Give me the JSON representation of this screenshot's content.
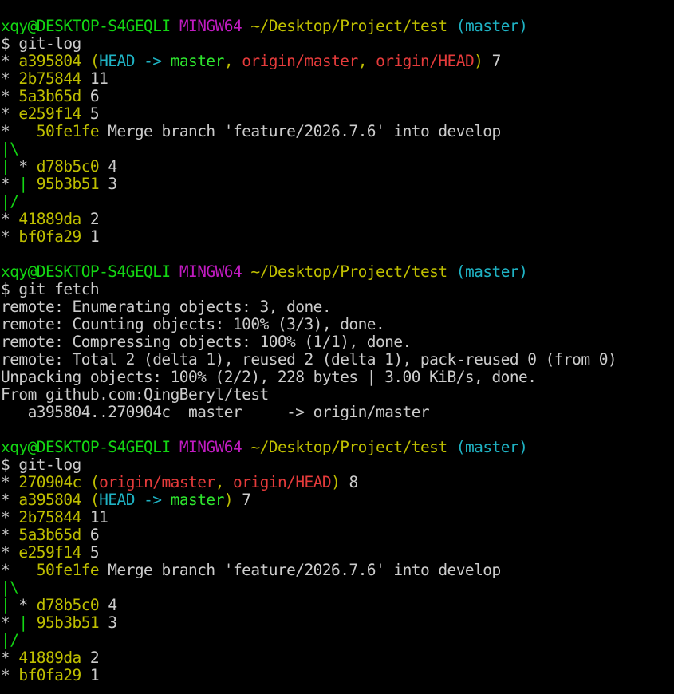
{
  "colors": {
    "default": "#cccccc",
    "green": "#13d613",
    "magenta": "#c11bc1",
    "yellow": "#bfbf00",
    "cyan": "#1fb3c4",
    "blue": "#2a8ff0",
    "red": "#e53b3b",
    "bright_green": "#2ee62e",
    "white": "#cccccc"
  },
  "lines": [
    {
      "type": "prompt",
      "segments": [
        {
          "text": "xqy@DESKTOP-S4GEQLI",
          "color": "green"
        },
        {
          "text": " ",
          "color": "default"
        },
        {
          "text": "MINGW64",
          "color": "magenta"
        },
        {
          "text": " ",
          "color": "default"
        },
        {
          "text": "~/Desktop/Project/test",
          "color": "yellow"
        },
        {
          "text": " ",
          "color": "default"
        },
        {
          "text": "(master)",
          "color": "cyan"
        }
      ]
    },
    {
      "type": "command",
      "segments": [
        {
          "text": "$ git-log",
          "color": "white"
        }
      ]
    },
    {
      "type": "log",
      "segments": [
        {
          "text": "* ",
          "color": "white"
        },
        {
          "text": "a395804",
          "color": "yellow"
        },
        {
          "text": " ",
          "color": "white"
        },
        {
          "text": "(",
          "color": "yellow"
        },
        {
          "text": "HEAD -> ",
          "color": "cyan"
        },
        {
          "text": "master",
          "color": "bright_green"
        },
        {
          "text": ", ",
          "color": "yellow"
        },
        {
          "text": "origin/master",
          "color": "red"
        },
        {
          "text": ", ",
          "color": "yellow"
        },
        {
          "text": "origin/HEAD",
          "color": "red"
        },
        {
          "text": ")",
          "color": "yellow"
        },
        {
          "text": " 7",
          "color": "white"
        }
      ]
    },
    {
      "type": "log",
      "segments": [
        {
          "text": "* ",
          "color": "white"
        },
        {
          "text": "2b75844",
          "color": "yellow"
        },
        {
          "text": " 11",
          "color": "white"
        }
      ]
    },
    {
      "type": "log",
      "segments": [
        {
          "text": "* ",
          "color": "white"
        },
        {
          "text": "5a3b65d",
          "color": "yellow"
        },
        {
          "text": " 6",
          "color": "white"
        }
      ]
    },
    {
      "type": "log",
      "segments": [
        {
          "text": "* ",
          "color": "white"
        },
        {
          "text": "e259f14",
          "color": "yellow"
        },
        {
          "text": " 5",
          "color": "white"
        }
      ]
    },
    {
      "type": "log",
      "segments": [
        {
          "text": "*   ",
          "color": "white"
        },
        {
          "text": "50fe1fe",
          "color": "yellow"
        },
        {
          "text": " Merge branch 'feature/2026.7.6' into develop",
          "color": "white"
        }
      ]
    },
    {
      "type": "graph",
      "segments": [
        {
          "text": "|\\",
          "color": "green"
        }
      ]
    },
    {
      "type": "log",
      "segments": [
        {
          "text": "|",
          "color": "green"
        },
        {
          "text": " * ",
          "color": "white"
        },
        {
          "text": "d78b5c0",
          "color": "yellow"
        },
        {
          "text": " 4",
          "color": "white"
        }
      ]
    },
    {
      "type": "log",
      "segments": [
        {
          "text": "* ",
          "color": "white"
        },
        {
          "text": "|",
          "color": "green"
        },
        {
          "text": " ",
          "color": "white"
        },
        {
          "text": "95b3b51",
          "color": "yellow"
        },
        {
          "text": " 3",
          "color": "white"
        }
      ]
    },
    {
      "type": "graph",
      "segments": [
        {
          "text": "|/",
          "color": "green"
        }
      ]
    },
    {
      "type": "log",
      "segments": [
        {
          "text": "* ",
          "color": "white"
        },
        {
          "text": "41889da",
          "color": "yellow"
        },
        {
          "text": " 2",
          "color": "white"
        }
      ]
    },
    {
      "type": "log",
      "segments": [
        {
          "text": "* ",
          "color": "white"
        },
        {
          "text": "bf0fa29",
          "color": "yellow"
        },
        {
          "text": " 1",
          "color": "white"
        }
      ]
    },
    {
      "type": "blank",
      "segments": []
    },
    {
      "type": "prompt",
      "segments": [
        {
          "text": "xqy@DESKTOP-S4GEQLI",
          "color": "green"
        },
        {
          "text": " ",
          "color": "default"
        },
        {
          "text": "MINGW64",
          "color": "magenta"
        },
        {
          "text": " ",
          "color": "default"
        },
        {
          "text": "~/Desktop/Project/test",
          "color": "yellow"
        },
        {
          "text": " ",
          "color": "default"
        },
        {
          "text": "(master)",
          "color": "cyan"
        }
      ]
    },
    {
      "type": "command",
      "segments": [
        {
          "text": "$ git fetch",
          "color": "white"
        }
      ]
    },
    {
      "type": "output",
      "segments": [
        {
          "text": "remote: Enumerating objects: 3, done.",
          "color": "white"
        }
      ]
    },
    {
      "type": "output",
      "segments": [
        {
          "text": "remote: Counting objects: 100% (3/3), done.",
          "color": "white"
        }
      ]
    },
    {
      "type": "output",
      "segments": [
        {
          "text": "remote: Compressing objects: 100% (1/1), done.",
          "color": "white"
        }
      ]
    },
    {
      "type": "output",
      "segments": [
        {
          "text": "remote: Total 2 (delta 1), reused 2 (delta 1), pack-reused 0 (from 0)",
          "color": "white"
        }
      ]
    },
    {
      "type": "output",
      "segments": [
        {
          "text": "Unpacking objects: 100% (2/2), 228 bytes | 3.00 KiB/s, done.",
          "color": "white"
        }
      ]
    },
    {
      "type": "output",
      "segments": [
        {
          "text": "From github.com:QingBeryl/test",
          "color": "white"
        }
      ]
    },
    {
      "type": "output",
      "segments": [
        {
          "text": "   a395804..270904c  master     -> origin/master",
          "color": "white"
        }
      ]
    },
    {
      "type": "blank",
      "segments": []
    },
    {
      "type": "prompt",
      "segments": [
        {
          "text": "xqy@DESKTOP-S4GEQLI",
          "color": "green"
        },
        {
          "text": " ",
          "color": "default"
        },
        {
          "text": "MINGW64",
          "color": "magenta"
        },
        {
          "text": " ",
          "color": "default"
        },
        {
          "text": "~/Desktop/Project/test",
          "color": "yellow"
        },
        {
          "text": " ",
          "color": "default"
        },
        {
          "text": "(master)",
          "color": "cyan"
        }
      ]
    },
    {
      "type": "command",
      "segments": [
        {
          "text": "$ git-log",
          "color": "white"
        }
      ]
    },
    {
      "type": "log",
      "segments": [
        {
          "text": "* ",
          "color": "white"
        },
        {
          "text": "270904c",
          "color": "yellow"
        },
        {
          "text": " ",
          "color": "white"
        },
        {
          "text": "(",
          "color": "yellow"
        },
        {
          "text": "origin/master",
          "color": "red"
        },
        {
          "text": ", ",
          "color": "yellow"
        },
        {
          "text": "origin/HEAD",
          "color": "red"
        },
        {
          "text": ")",
          "color": "yellow"
        },
        {
          "text": " 8",
          "color": "white"
        }
      ]
    },
    {
      "type": "log",
      "segments": [
        {
          "text": "* ",
          "color": "white"
        },
        {
          "text": "a395804",
          "color": "yellow"
        },
        {
          "text": " ",
          "color": "white"
        },
        {
          "text": "(",
          "color": "yellow"
        },
        {
          "text": "HEAD -> ",
          "color": "cyan"
        },
        {
          "text": "master",
          "color": "bright_green"
        },
        {
          "text": ")",
          "color": "yellow"
        },
        {
          "text": " 7",
          "color": "white"
        }
      ]
    },
    {
      "type": "log",
      "segments": [
        {
          "text": "* ",
          "color": "white"
        },
        {
          "text": "2b75844",
          "color": "yellow"
        },
        {
          "text": " 11",
          "color": "white"
        }
      ]
    },
    {
      "type": "log",
      "segments": [
        {
          "text": "* ",
          "color": "white"
        },
        {
          "text": "5a3b65d",
          "color": "yellow"
        },
        {
          "text": " 6",
          "color": "white"
        }
      ]
    },
    {
      "type": "log",
      "segments": [
        {
          "text": "* ",
          "color": "white"
        },
        {
          "text": "e259f14",
          "color": "yellow"
        },
        {
          "text": " 5",
          "color": "white"
        }
      ]
    },
    {
      "type": "log",
      "segments": [
        {
          "text": "*   ",
          "color": "white"
        },
        {
          "text": "50fe1fe",
          "color": "yellow"
        },
        {
          "text": " Merge branch 'feature/2026.7.6' into develop",
          "color": "white"
        }
      ]
    },
    {
      "type": "graph",
      "segments": [
        {
          "text": "|\\",
          "color": "green"
        }
      ]
    },
    {
      "type": "log",
      "segments": [
        {
          "text": "|",
          "color": "green"
        },
        {
          "text": " * ",
          "color": "white"
        },
        {
          "text": "d78b5c0",
          "color": "yellow"
        },
        {
          "text": " 4",
          "color": "white"
        }
      ]
    },
    {
      "type": "log",
      "segments": [
        {
          "text": "* ",
          "color": "white"
        },
        {
          "text": "|",
          "color": "green"
        },
        {
          "text": " ",
          "color": "white"
        },
        {
          "text": "95b3b51",
          "color": "yellow"
        },
        {
          "text": " 3",
          "color": "white"
        }
      ]
    },
    {
      "type": "graph",
      "segments": [
        {
          "text": "|/",
          "color": "green"
        }
      ]
    },
    {
      "type": "log",
      "segments": [
        {
          "text": "* ",
          "color": "white"
        },
        {
          "text": "41889da",
          "color": "yellow"
        },
        {
          "text": " 2",
          "color": "white"
        }
      ]
    },
    {
      "type": "log",
      "segments": [
        {
          "text": "* ",
          "color": "white"
        },
        {
          "text": "bf0fa29",
          "color": "yellow"
        },
        {
          "text": " 1",
          "color": "white"
        }
      ]
    }
  ]
}
